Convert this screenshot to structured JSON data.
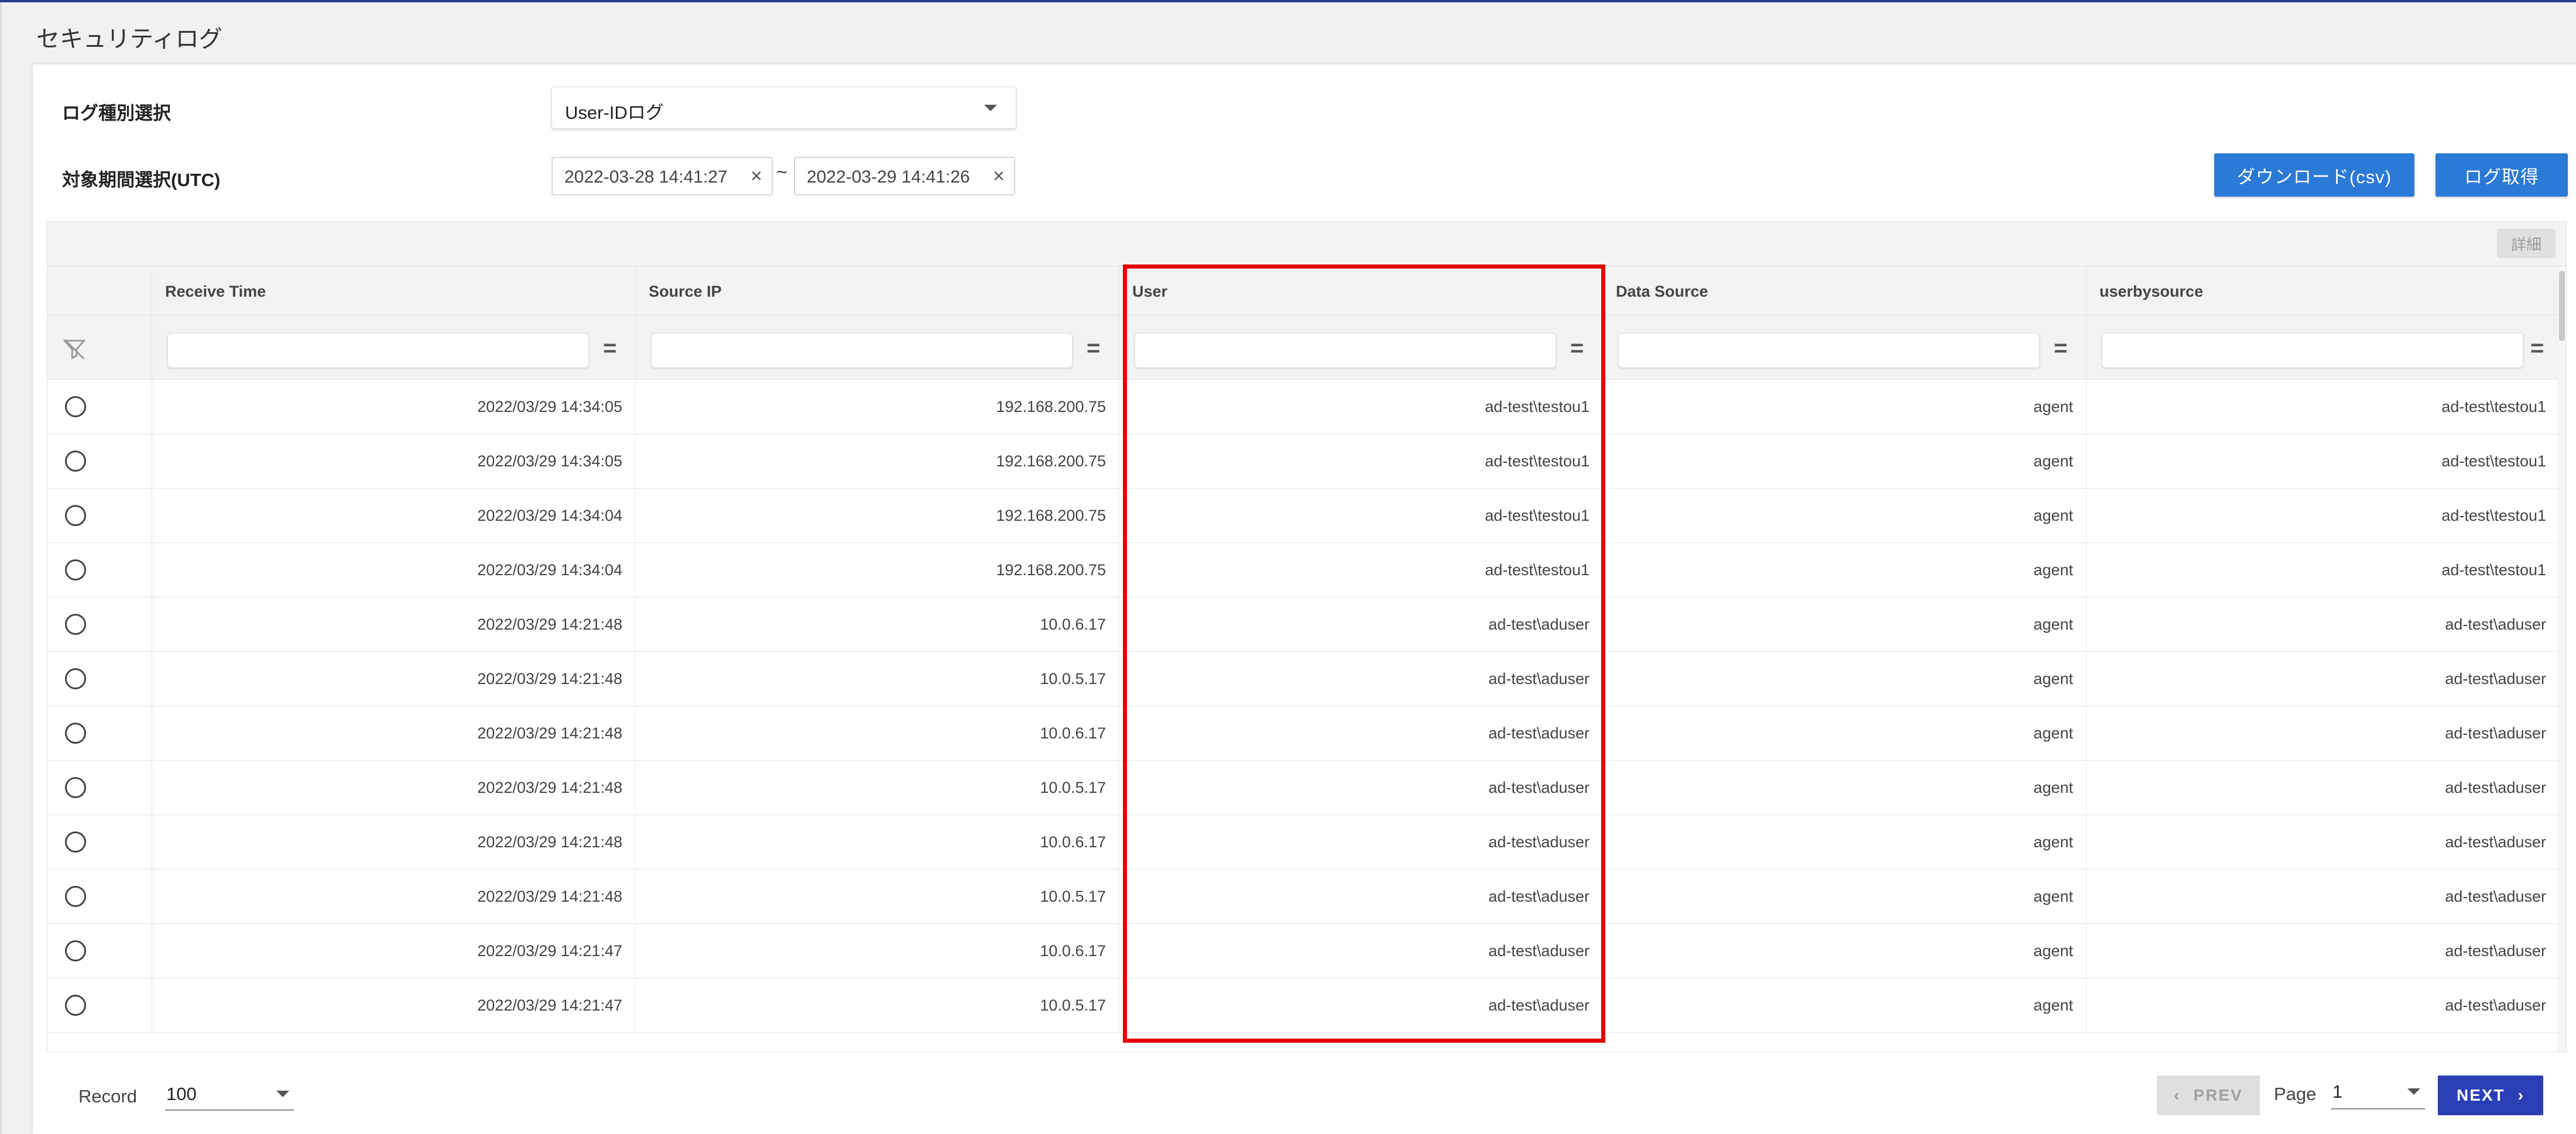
{
  "page": {
    "title": "セキュリティログ"
  },
  "form": {
    "log_type_label": "ログ種別選択",
    "log_type_value": "User-IDログ",
    "period_label": "対象期間選択(UTC)",
    "date_from": "2022-03-28 14:41:27",
    "date_to": "2022-03-29 14:41:26",
    "range_separator": "~",
    "clear_glyph": "×"
  },
  "actions": {
    "download_label": "ダウンロード(csv)",
    "fetch_label": "ログ取得"
  },
  "grid": {
    "detail_label": "詳細",
    "columns": [
      "Receive Time",
      "Source IP",
      "User",
      "Data Source",
      "userbysource"
    ],
    "filter_glyph": "=",
    "rows": [
      {
        "receive_time": "2022/03/29 14:34:05",
        "source_ip": "192.168.200.75",
        "user": "ad-test\\testou1",
        "data_source": "agent",
        "userbysource": "ad-test\\testou1"
      },
      {
        "receive_time": "2022/03/29 14:34:05",
        "source_ip": "192.168.200.75",
        "user": "ad-test\\testou1",
        "data_source": "agent",
        "userbysource": "ad-test\\testou1"
      },
      {
        "receive_time": "2022/03/29 14:34:04",
        "source_ip": "192.168.200.75",
        "user": "ad-test\\testou1",
        "data_source": "agent",
        "userbysource": "ad-test\\testou1"
      },
      {
        "receive_time": "2022/03/29 14:34:04",
        "source_ip": "192.168.200.75",
        "user": "ad-test\\testou1",
        "data_source": "agent",
        "userbysource": "ad-test\\testou1"
      },
      {
        "receive_time": "2022/03/29 14:21:48",
        "source_ip": "10.0.6.17",
        "user": "ad-test\\aduser",
        "data_source": "agent",
        "userbysource": "ad-test\\aduser"
      },
      {
        "receive_time": "2022/03/29 14:21:48",
        "source_ip": "10.0.5.17",
        "user": "ad-test\\aduser",
        "data_source": "agent",
        "userbysource": "ad-test\\aduser"
      },
      {
        "receive_time": "2022/03/29 14:21:48",
        "source_ip": "10.0.6.17",
        "user": "ad-test\\aduser",
        "data_source": "agent",
        "userbysource": "ad-test\\aduser"
      },
      {
        "receive_time": "2022/03/29 14:21:48",
        "source_ip": "10.0.5.17",
        "user": "ad-test\\aduser",
        "data_source": "agent",
        "userbysource": "ad-test\\aduser"
      },
      {
        "receive_time": "2022/03/29 14:21:48",
        "source_ip": "10.0.6.17",
        "user": "ad-test\\aduser",
        "data_source": "agent",
        "userbysource": "ad-test\\aduser"
      },
      {
        "receive_time": "2022/03/29 14:21:48",
        "source_ip": "10.0.5.17",
        "user": "ad-test\\aduser",
        "data_source": "agent",
        "userbysource": "ad-test\\aduser"
      },
      {
        "receive_time": "2022/03/29 14:21:47",
        "source_ip": "10.0.6.17",
        "user": "ad-test\\aduser",
        "data_source": "agent",
        "userbysource": "ad-test\\aduser"
      },
      {
        "receive_time": "2022/03/29 14:21:47",
        "source_ip": "10.0.5.17",
        "user": "ad-test\\aduser",
        "data_source": "agent",
        "userbysource": "ad-test\\aduser"
      }
    ]
  },
  "footer": {
    "record_label": "Record",
    "record_value": "100",
    "prev_label": "PREV",
    "page_label": "Page",
    "page_value": "1",
    "next_label": "NEXT",
    "prev_glyph": "‹",
    "next_glyph": "›"
  },
  "colors": {
    "primary": "#2b7ad6",
    "next": "#2a3fb5",
    "highlight": "#e60000"
  }
}
